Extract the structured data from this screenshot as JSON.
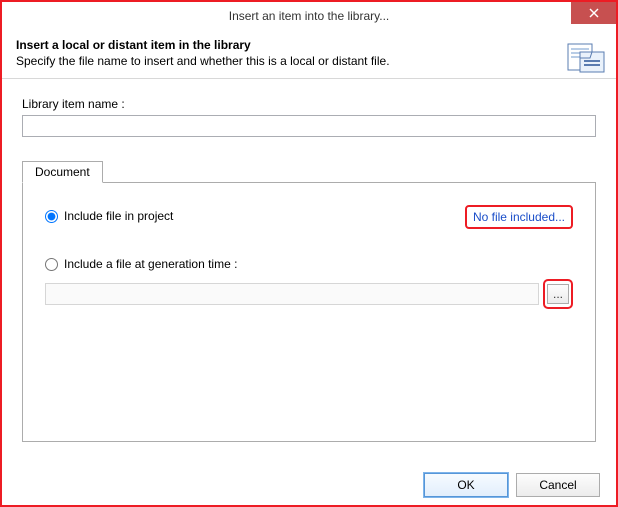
{
  "titlebar": {
    "title": "Insert an item into the library..."
  },
  "header": {
    "title": "Insert a local or distant item in the library",
    "subtitle": "Specify the file name to insert and whether this is a local or distant file."
  },
  "form": {
    "item_name_label": "Library item name :",
    "item_name_value": ""
  },
  "tabs": {
    "document_label": "Document"
  },
  "document_tab": {
    "include_project_label": "Include file in project",
    "no_file_text": "No file included...",
    "include_gen_label": "Include a file at generation time :",
    "gen_path_value": "",
    "browse_label": "..."
  },
  "footer": {
    "ok": "OK",
    "cancel": "Cancel"
  }
}
